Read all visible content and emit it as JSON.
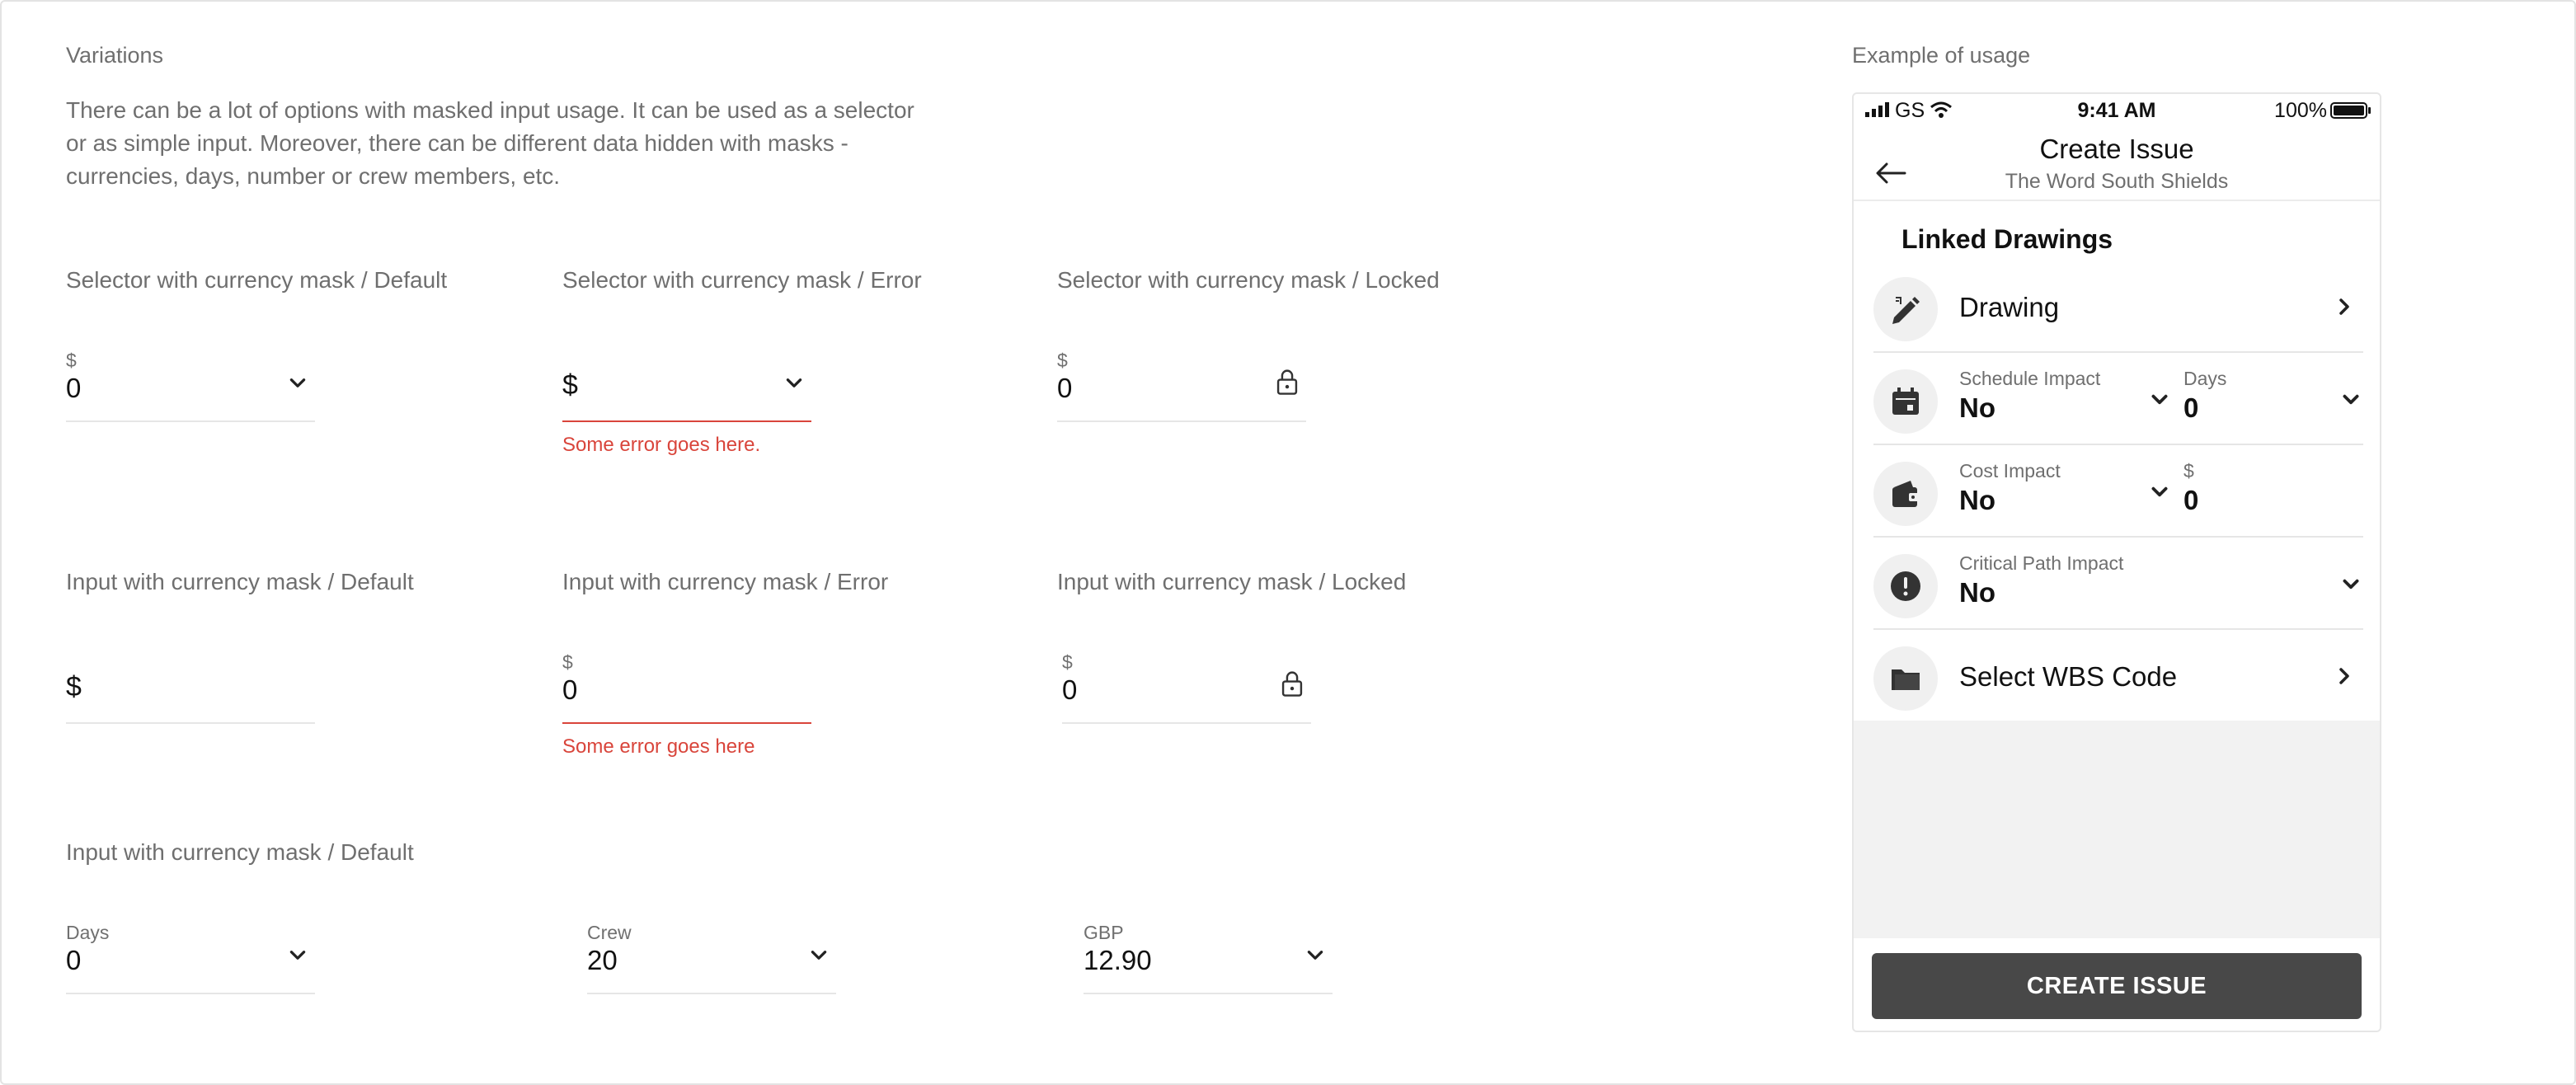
{
  "variations": {
    "title": "Variations",
    "description": "There can be a lot of options with masked input usage. It can be used as a selector or as simple input. Moreover, there can be different data hidden with masks - currencies, days, number or crew members, etc."
  },
  "selectors": {
    "default": {
      "label": "Selector with currency mask / Default",
      "prefix": "$",
      "value": "0"
    },
    "error": {
      "label": "Selector with currency mask / Error",
      "prefix": "$",
      "error": "Some error goes here."
    },
    "locked": {
      "label": "Selector with currency mask / Locked",
      "prefix": "$",
      "value": "0"
    }
  },
  "inputs": {
    "default": {
      "label": "Input with currency mask / Default",
      "prefix": "$"
    },
    "error": {
      "label": "Input with currency mask / Error",
      "prefix": "$",
      "value": "0",
      "error": "Some error goes here"
    },
    "locked": {
      "label": "Input with currency mask / Locked",
      "prefix": "$",
      "value": "0"
    }
  },
  "masks": {
    "label": "Input with currency mask / Default",
    "days": {
      "label": "Days",
      "value": "0"
    },
    "crew": {
      "label": "Crew",
      "value": "20"
    },
    "gbp": {
      "label": "GBP",
      "value": "12.90"
    }
  },
  "example": {
    "title": "Example of usage",
    "status": {
      "carrier": "GS",
      "time": "9:41 AM",
      "battery": "100%"
    },
    "header": {
      "title": "Create Issue",
      "subtitle": "The Word South Shields"
    },
    "section": "Linked Drawings",
    "rows": {
      "drawing": "Drawing",
      "schedule": {
        "label": "Schedule Impact",
        "value": "No",
        "days_label": "Days",
        "days_value": "0"
      },
      "cost": {
        "label": "Cost Impact",
        "value": "No",
        "currency_label": "$",
        "currency_value": "0"
      },
      "critical": {
        "label": "Critical Path Impact",
        "value": "No"
      },
      "wbs": "Select WBS Code"
    },
    "button": "CREATE ISSUE"
  },
  "colors": {
    "error": "#d9453b",
    "button": "#484848",
    "muted": "#6f6f6f"
  }
}
